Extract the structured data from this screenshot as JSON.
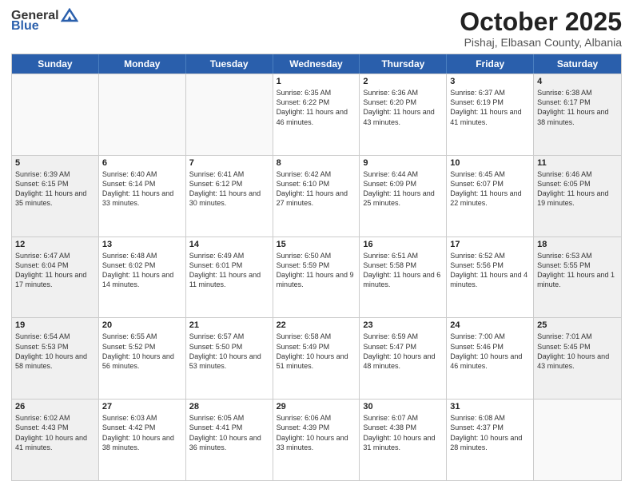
{
  "header": {
    "logo_general": "General",
    "logo_blue": "Blue",
    "month": "October 2025",
    "location": "Pishaj, Elbasan County, Albania"
  },
  "weekdays": [
    "Sunday",
    "Monday",
    "Tuesday",
    "Wednesday",
    "Thursday",
    "Friday",
    "Saturday"
  ],
  "rows": [
    [
      {
        "day": "",
        "info": "",
        "empty": true
      },
      {
        "day": "",
        "info": "",
        "empty": true
      },
      {
        "day": "",
        "info": "",
        "empty": true
      },
      {
        "day": "1",
        "info": "Sunrise: 6:35 AM\nSunset: 6:22 PM\nDaylight: 11 hours and 46 minutes.",
        "shaded": false
      },
      {
        "day": "2",
        "info": "Sunrise: 6:36 AM\nSunset: 6:20 PM\nDaylight: 11 hours and 43 minutes.",
        "shaded": false
      },
      {
        "day": "3",
        "info": "Sunrise: 6:37 AM\nSunset: 6:19 PM\nDaylight: 11 hours and 41 minutes.",
        "shaded": false
      },
      {
        "day": "4",
        "info": "Sunrise: 6:38 AM\nSunset: 6:17 PM\nDaylight: 11 hours and 38 minutes.",
        "shaded": true
      }
    ],
    [
      {
        "day": "5",
        "info": "Sunrise: 6:39 AM\nSunset: 6:15 PM\nDaylight: 11 hours and 35 minutes.",
        "shaded": true
      },
      {
        "day": "6",
        "info": "Sunrise: 6:40 AM\nSunset: 6:14 PM\nDaylight: 11 hours and 33 minutes.",
        "shaded": false
      },
      {
        "day": "7",
        "info": "Sunrise: 6:41 AM\nSunset: 6:12 PM\nDaylight: 11 hours and 30 minutes.",
        "shaded": false
      },
      {
        "day": "8",
        "info": "Sunrise: 6:42 AM\nSunset: 6:10 PM\nDaylight: 11 hours and 27 minutes.",
        "shaded": false
      },
      {
        "day": "9",
        "info": "Sunrise: 6:44 AM\nSunset: 6:09 PM\nDaylight: 11 hours and 25 minutes.",
        "shaded": false
      },
      {
        "day": "10",
        "info": "Sunrise: 6:45 AM\nSunset: 6:07 PM\nDaylight: 11 hours and 22 minutes.",
        "shaded": false
      },
      {
        "day": "11",
        "info": "Sunrise: 6:46 AM\nSunset: 6:05 PM\nDaylight: 11 hours and 19 minutes.",
        "shaded": true
      }
    ],
    [
      {
        "day": "12",
        "info": "Sunrise: 6:47 AM\nSunset: 6:04 PM\nDaylight: 11 hours and 17 minutes.",
        "shaded": true
      },
      {
        "day": "13",
        "info": "Sunrise: 6:48 AM\nSunset: 6:02 PM\nDaylight: 11 hours and 14 minutes.",
        "shaded": false
      },
      {
        "day": "14",
        "info": "Sunrise: 6:49 AM\nSunset: 6:01 PM\nDaylight: 11 hours and 11 minutes.",
        "shaded": false
      },
      {
        "day": "15",
        "info": "Sunrise: 6:50 AM\nSunset: 5:59 PM\nDaylight: 11 hours and 9 minutes.",
        "shaded": false
      },
      {
        "day": "16",
        "info": "Sunrise: 6:51 AM\nSunset: 5:58 PM\nDaylight: 11 hours and 6 minutes.",
        "shaded": false
      },
      {
        "day": "17",
        "info": "Sunrise: 6:52 AM\nSunset: 5:56 PM\nDaylight: 11 hours and 4 minutes.",
        "shaded": false
      },
      {
        "day": "18",
        "info": "Sunrise: 6:53 AM\nSunset: 5:55 PM\nDaylight: 11 hours and 1 minute.",
        "shaded": true
      }
    ],
    [
      {
        "day": "19",
        "info": "Sunrise: 6:54 AM\nSunset: 5:53 PM\nDaylight: 10 hours and 58 minutes.",
        "shaded": true
      },
      {
        "day": "20",
        "info": "Sunrise: 6:55 AM\nSunset: 5:52 PM\nDaylight: 10 hours and 56 minutes.",
        "shaded": false
      },
      {
        "day": "21",
        "info": "Sunrise: 6:57 AM\nSunset: 5:50 PM\nDaylight: 10 hours and 53 minutes.",
        "shaded": false
      },
      {
        "day": "22",
        "info": "Sunrise: 6:58 AM\nSunset: 5:49 PM\nDaylight: 10 hours and 51 minutes.",
        "shaded": false
      },
      {
        "day": "23",
        "info": "Sunrise: 6:59 AM\nSunset: 5:47 PM\nDaylight: 10 hours and 48 minutes.",
        "shaded": false
      },
      {
        "day": "24",
        "info": "Sunrise: 7:00 AM\nSunset: 5:46 PM\nDaylight: 10 hours and 46 minutes.",
        "shaded": false
      },
      {
        "day": "25",
        "info": "Sunrise: 7:01 AM\nSunset: 5:45 PM\nDaylight: 10 hours and 43 minutes.",
        "shaded": true
      }
    ],
    [
      {
        "day": "26",
        "info": "Sunrise: 6:02 AM\nSunset: 4:43 PM\nDaylight: 10 hours and 41 minutes.",
        "shaded": true
      },
      {
        "day": "27",
        "info": "Sunrise: 6:03 AM\nSunset: 4:42 PM\nDaylight: 10 hours and 38 minutes.",
        "shaded": false
      },
      {
        "day": "28",
        "info": "Sunrise: 6:05 AM\nSunset: 4:41 PM\nDaylight: 10 hours and 36 minutes.",
        "shaded": false
      },
      {
        "day": "29",
        "info": "Sunrise: 6:06 AM\nSunset: 4:39 PM\nDaylight: 10 hours and 33 minutes.",
        "shaded": false
      },
      {
        "day": "30",
        "info": "Sunrise: 6:07 AM\nSunset: 4:38 PM\nDaylight: 10 hours and 31 minutes.",
        "shaded": false
      },
      {
        "day": "31",
        "info": "Sunrise: 6:08 AM\nSunset: 4:37 PM\nDaylight: 10 hours and 28 minutes.",
        "shaded": false
      },
      {
        "day": "",
        "info": "",
        "empty": true
      }
    ]
  ]
}
